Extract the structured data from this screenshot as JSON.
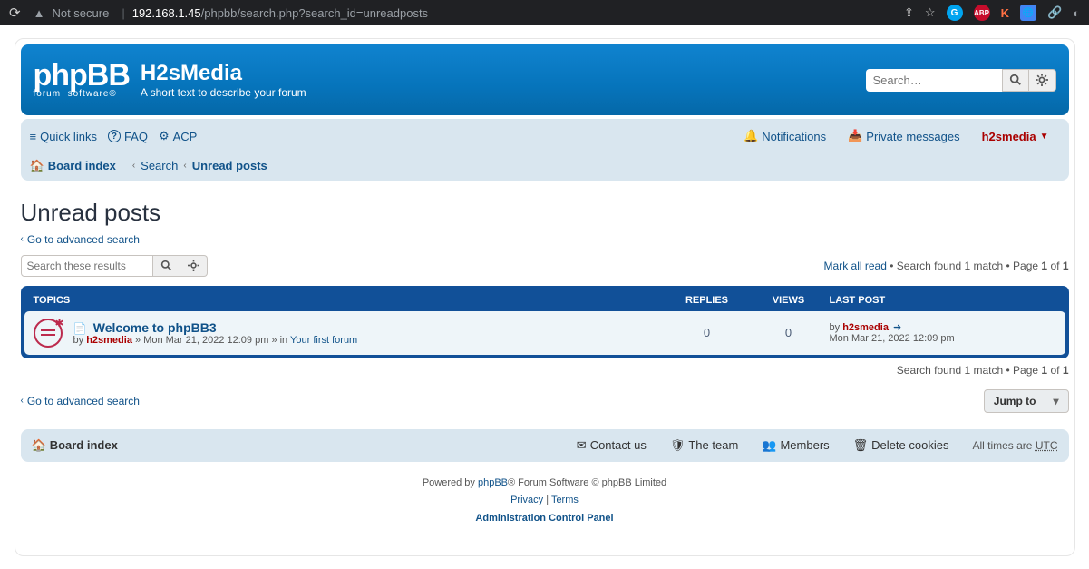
{
  "browser": {
    "not_secure": "Not secure",
    "url_host": "192.168.1.45",
    "url_path": "/phpbb/search.php?search_id=unreadposts"
  },
  "header": {
    "site_title": "H2sMedia",
    "site_desc": "A short text to describe your forum",
    "search_placeholder": "Search…"
  },
  "nav": {
    "quick_links": "Quick links",
    "faq": "FAQ",
    "acp": "ACP",
    "notifications": "Notifications",
    "private_messages": "Private messages",
    "username": "h2smedia",
    "board_index": "Board index",
    "search": "Search",
    "unread_posts": "Unread posts"
  },
  "page_title": "Unread posts",
  "adv_search": "Go to advanced search",
  "search_results_placeholder": "Search these results",
  "pagination_top": {
    "mark_all": "Mark all read",
    "found_prefix": "Search found 1 match",
    "page_prefix": "Page",
    "page": "1",
    "of": "of",
    "total": "1"
  },
  "table_headers": {
    "topics": "Topics",
    "replies": "Replies",
    "views": "Views",
    "last_post": "Last post"
  },
  "topics": [
    {
      "title": "Welcome to phpBB3",
      "by_label": "by",
      "author": "h2smedia",
      "date": "Mon Mar 21, 2022 12:09 pm",
      "in_label": "» in",
      "forum": "Your first forum",
      "replies": "0",
      "views": "0",
      "last_by_label": "by",
      "last_author": "h2smedia",
      "last_date": "Mon Mar 21, 2022 12:09 pm"
    }
  ],
  "pagination_bottom": {
    "found_prefix": "Search found 1 match",
    "page_prefix": "Page",
    "page": "1",
    "of": "of",
    "total": "1"
  },
  "jump_to": "Jump to",
  "footer": {
    "board_index": "Board index",
    "contact": "Contact us",
    "team": "The team",
    "members": "Members",
    "delete_cookies": "Delete cookies",
    "tz_prefix": "All times are",
    "tz": "UTC"
  },
  "copyright": {
    "powered_prefix": "Powered by",
    "phpbb": "phpBB",
    "powered_suffix": "® Forum Software © phpBB Limited",
    "privacy": "Privacy",
    "terms": "Terms",
    "acp": "Administration Control Panel"
  }
}
